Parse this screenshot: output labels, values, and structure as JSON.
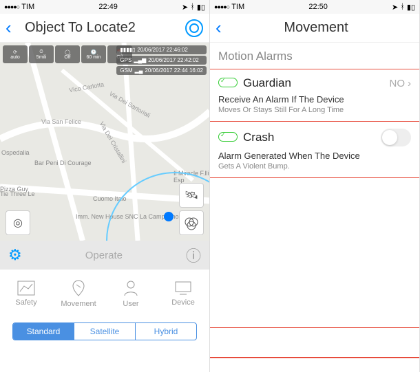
{
  "left": {
    "status": {
      "carrier": "TIM",
      "time": "22:49",
      "dots": "●●●●○"
    },
    "nav": {
      "title": "Object To Locate2"
    },
    "strips": {
      "battery": "20/06/2017 22:46:02",
      "gps": "GPS",
      "gps_ts": "20/06/2017 22:42:02",
      "gsm": "GSM",
      "gsm_ts": "20/06/2017 22:44 16:02"
    },
    "badges": [
      "auto",
      "5mili",
      "Off",
      "60 min",
      "Off"
    ],
    "map_labels": {
      "carlotta": "Vico Carlotta",
      "vds": "Via Dei Sartoriali",
      "felice": "Via San Felice",
      "vdc": "Via Dei Cristallini",
      "bar": "Bar Peni Di Courage",
      "pizza": "Pizza Guy",
      "cuomo": "Cuomo Italo",
      "imm": "Imm. New House SNC La Campognola",
      "miracle": "Il Miracle F.lli Esp",
      "tie": "Tie Three Le",
      "ospedalia": "Ospedalia"
    },
    "operate": {
      "label": "Operate"
    },
    "tabs": {
      "safety": "Safety",
      "movement": "Movement",
      "user": "User",
      "device": "Device"
    },
    "seg": {
      "standard": "Standard",
      "satellite": "Satellite",
      "hybrid": "Hybrid"
    }
  },
  "right": {
    "status": {
      "carrier": "TIM",
      "time": "22:50",
      "dots": "●●●●○"
    },
    "nav": {
      "title": "Movement"
    },
    "section": "Motion Alarms",
    "guardian": {
      "title": "Guardian",
      "value": "NO",
      "desc1": "Receive An Alarm If The Device",
      "desc2": "Moves Or Stays Still For A Long Time"
    },
    "crash": {
      "title": "Crash",
      "desc1": "Alarm Generated When The Device",
      "desc2": "Gets A Violent Bump."
    }
  }
}
